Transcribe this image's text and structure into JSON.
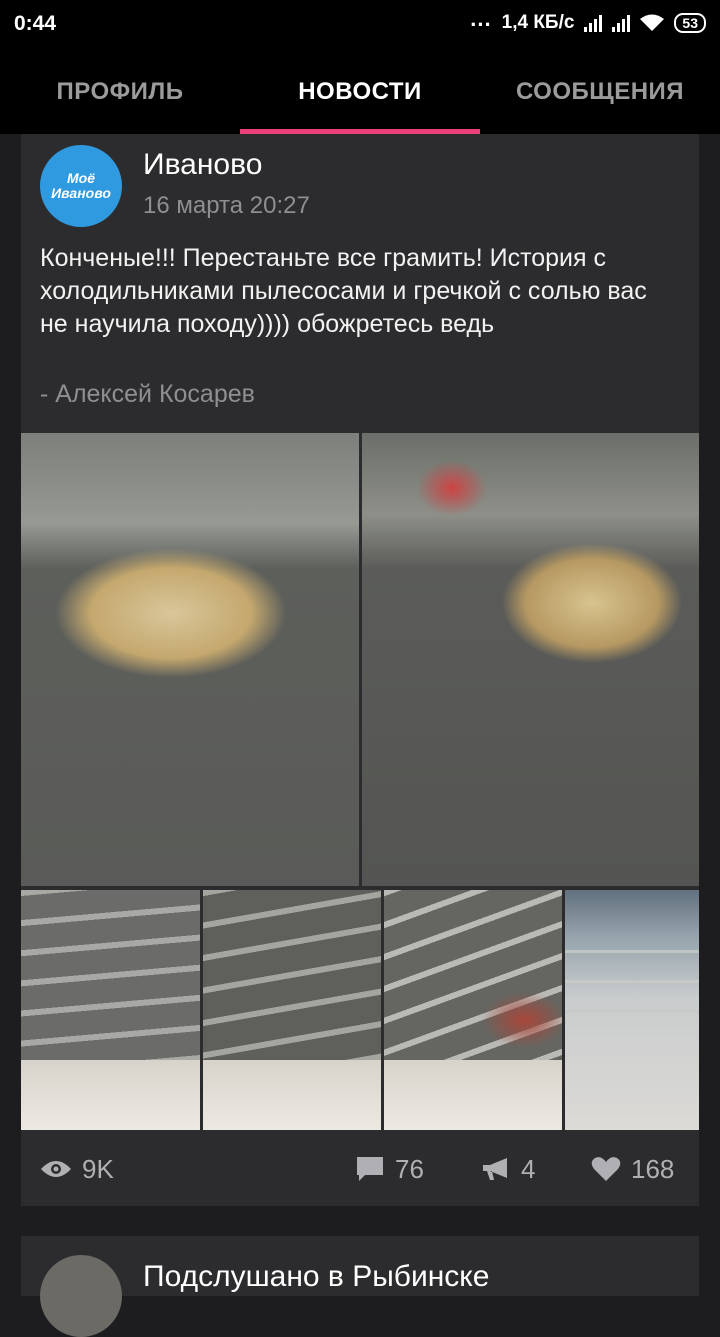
{
  "status_bar": {
    "time": "0:44",
    "dots": "...",
    "network_speed": "1,4 КБ/с",
    "battery": "53"
  },
  "tabs": [
    {
      "label": "ПРОФИЛЬ",
      "active": false
    },
    {
      "label": "НОВОСТИ",
      "active": true
    },
    {
      "label": "СООБЩЕНИЯ",
      "active": false
    }
  ],
  "post": {
    "avatar_text_1": "Моё",
    "avatar_text_2": "Иваново",
    "author": "Иваново",
    "date": "16 марта 20:27",
    "text": "Конченые!!! Перестаньте все грамить! История с холодильниками пылесосами и гречкой с солью вас не научила походу)))) обожретесь ведь",
    "signature": "- Алексей Косарев",
    "stats": {
      "views": "9K",
      "comments": "76",
      "reposts": "4",
      "likes": "168"
    }
  },
  "next_post": {
    "author": "Подслушано в Рыбинске"
  },
  "colors": {
    "accent": "#ec407a",
    "card_bg": "#2c2c2e",
    "avatar": "#2f9ae0"
  }
}
